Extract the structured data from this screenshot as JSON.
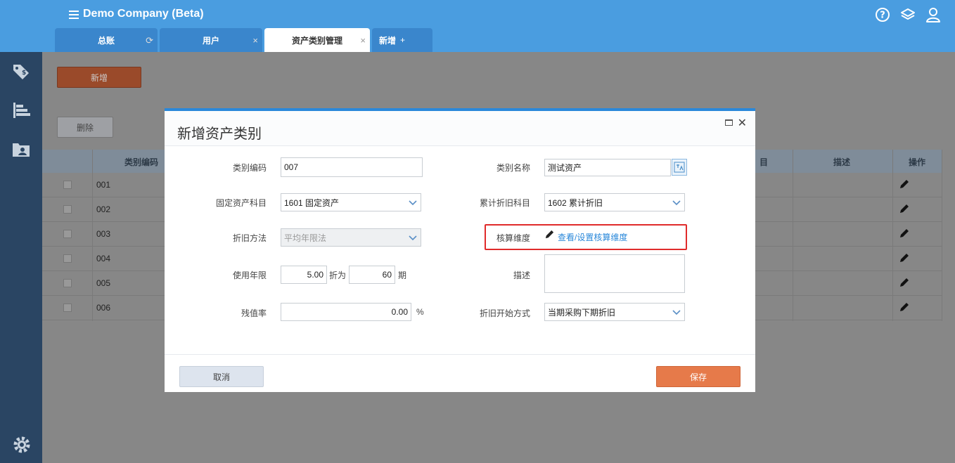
{
  "app": {
    "title": "Demo Company (Beta)"
  },
  "tabs": [
    {
      "label": "总账",
      "close": "⟳"
    },
    {
      "label": "用户",
      "close": "×"
    },
    {
      "label": "资产类别管理",
      "close": "×"
    },
    {
      "label": "新增",
      "close": "+"
    }
  ],
  "background": {
    "add_button": "新增",
    "delete_button": "删除",
    "columns": {
      "code": "类别编码",
      "account": "目",
      "desc": "描述",
      "ops": "操作"
    },
    "rows": [
      "001",
      "002",
      "003",
      "004",
      "005",
      "006"
    ]
  },
  "dialog": {
    "title": "新增资产类别",
    "fields": {
      "category_code_label": "类别编码",
      "category_code_value": "007",
      "category_name_label": "类别名称",
      "category_name_value": "测试资产",
      "fixed_asset_account_label": "固定资产科目",
      "fixed_asset_account_value": "1601 固定资产",
      "accum_depr_account_label": "累计折旧科目",
      "accum_depr_account_value": "1602 累计折旧",
      "depr_method_label": "折旧方法",
      "depr_method_value": "平均年限法",
      "accounting_dim_label": "核算维度",
      "accounting_dim_link": "查看/设置核算维度",
      "useful_life_label": "使用年限",
      "useful_life_value": "5.00",
      "depr_as_label": "折为",
      "periods_value": "60",
      "periods_unit": "期",
      "description_label": "描述",
      "description_value": "",
      "residual_rate_label": "残值率",
      "residual_rate_value": "0.00",
      "residual_rate_unit": "%",
      "depr_start_label": "折旧开始方式",
      "depr_start_value": "当期采购下期折旧"
    },
    "cancel_button": "取消",
    "save_button": "保存"
  },
  "colors": {
    "header_blue": "#4a9de0",
    "rail": "#2a4563",
    "save": "#e67a4a",
    "highlight": "#e02b2b"
  }
}
